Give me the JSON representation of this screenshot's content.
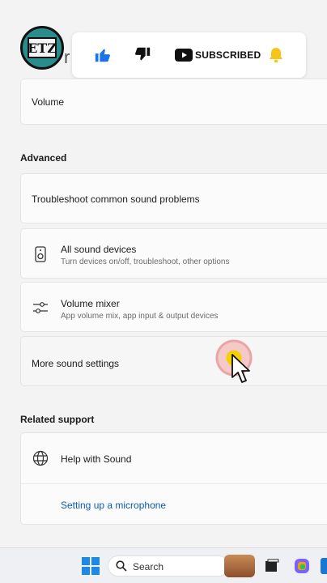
{
  "header": {
    "partial_title": "r"
  },
  "overlay": {
    "logo_text": "ETZ",
    "subscribed_label": "SUBSCRIBED"
  },
  "volume_card": {
    "label": "Volume"
  },
  "advanced": {
    "title": "Advanced",
    "troubleshoot_label": "Troubleshoot common sound problems",
    "all_devices": {
      "title": "All sound devices",
      "subtitle": "Turn devices on/off, troubleshoot, other options"
    },
    "volume_mixer": {
      "title": "Volume mixer",
      "subtitle": "App volume mix, app input & output devices"
    },
    "more_settings_label": "More sound settings"
  },
  "related": {
    "title": "Related support",
    "help_label": "Help with Sound",
    "link_label": "Setting up a microphone"
  },
  "taskbar": {
    "search_label": "Search"
  },
  "colors": {
    "accent_blue": "#1a73e8",
    "link_blue": "#0b5cad",
    "bell_yellow": "#f5c518"
  }
}
